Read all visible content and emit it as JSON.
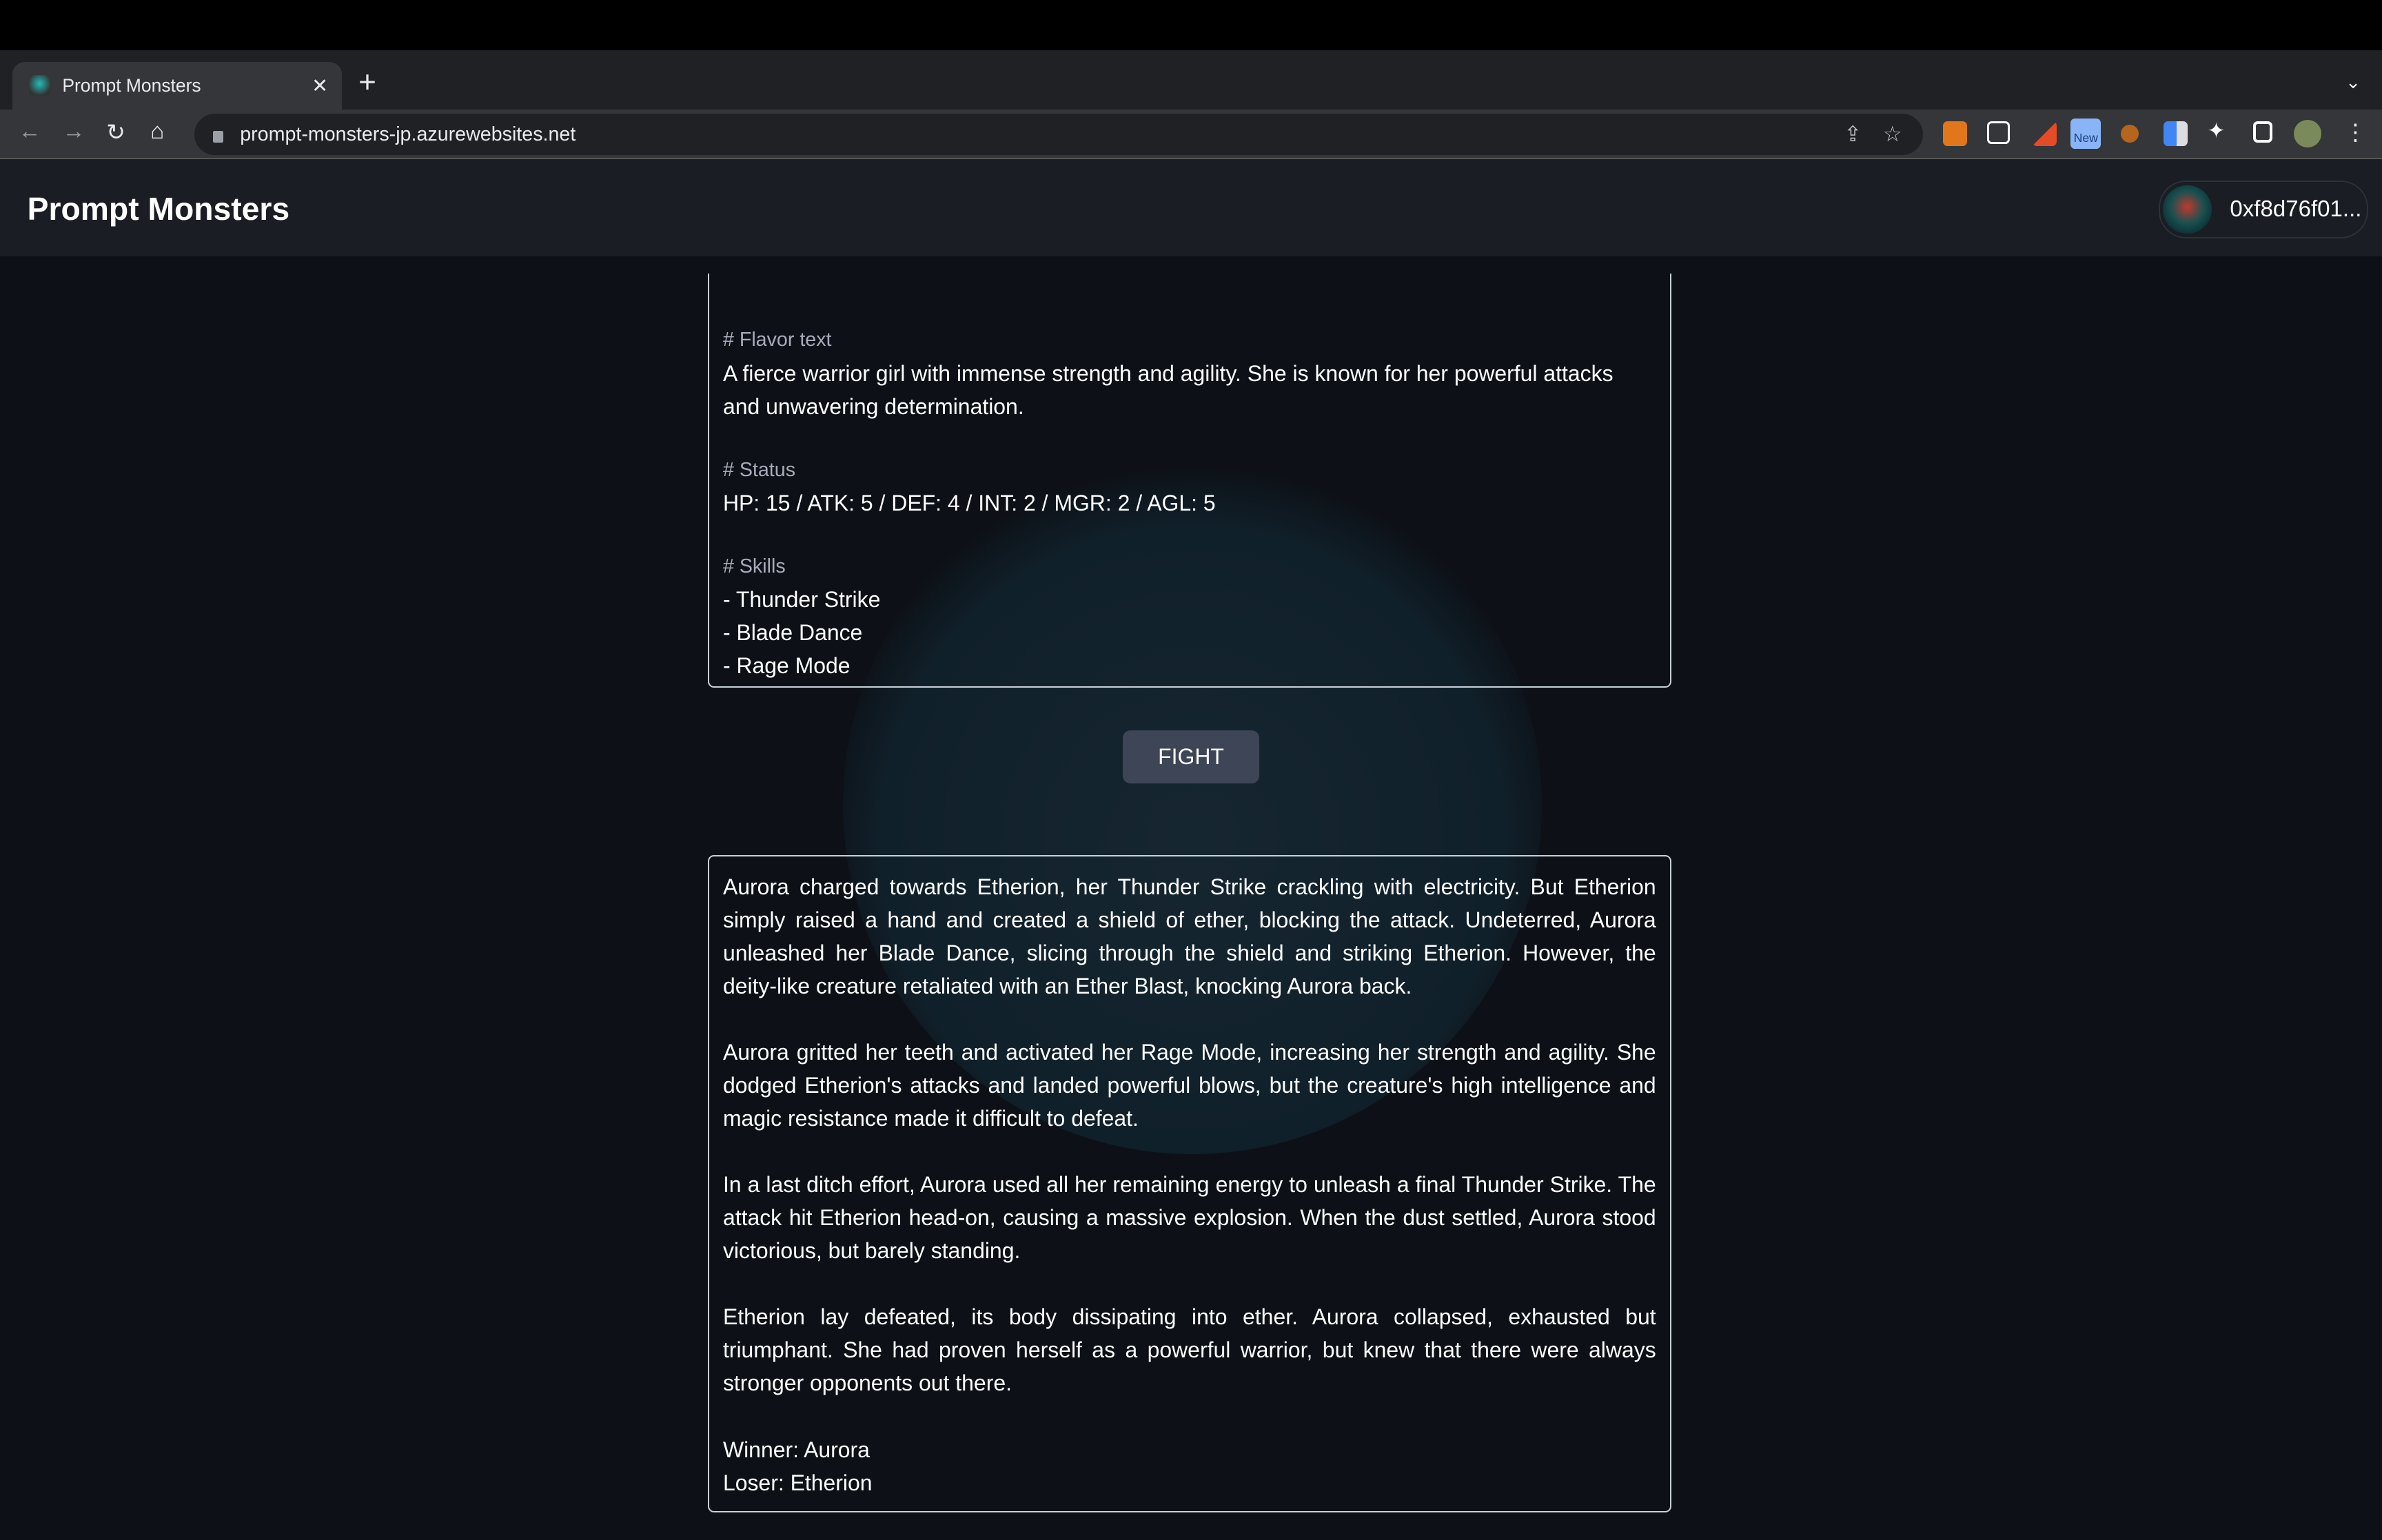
{
  "browser": {
    "tab_title": "Prompt Monsters",
    "tab_close": "✕",
    "new_tab": "+",
    "tab_menu": "⌄",
    "url": "prompt-monsters-jp.azurewebsites.net",
    "extensions": [
      "metamask-icon",
      "send-icon",
      "pen-icon",
      "new-extension-icon",
      "hedgehog-icon",
      "google-translate-icon",
      "puzzle-icon",
      "sidepanel-icon",
      "profile-avatar"
    ],
    "new_badge": "New"
  },
  "header": {
    "title": "Prompt Monsters",
    "wallet_address": "0xf8d76f01..."
  },
  "monster": {
    "flavor_label": "# Flavor text",
    "flavor_text": "A fierce warrior girl with immense strength and agility. She is known for her powerful attacks and unwavering determination.",
    "status_label": "# Status",
    "status_text": "HP: 15 / ATK: 5 / DEF: 4 / INT: 2 / MGR: 2 / AGL: 5",
    "skills_label": "# Skills",
    "skills": [
      "- Thunder Strike",
      "- Blade Dance",
      "- Rage Mode"
    ]
  },
  "fight_button": "FIGHT",
  "battle": {
    "paragraphs": [
      "Aurora charged towards Etherion, her Thunder Strike crackling with electricity. But Etherion simply raised a hand and created a shield of ether, blocking the attack. Undeterred, Aurora unleashed her Blade Dance, slicing through the shield and striking Etherion. However, the deity-like creature retaliated with an Ether Blast, knocking Aurora back.",
      "Aurora gritted her teeth and activated her Rage Mode, increasing her strength and agility. She dodged Etherion's attacks and landed powerful blows, but the creature's high intelligence and magic resistance made it difficult to defeat.",
      "In a last ditch effort, Aurora used all her remaining energy to unleash a final Thunder Strike. The attack hit Etherion head-on, causing a massive explosion. When the dust settled, Aurora stood victorious, but barely standing.",
      "Etherion lay defeated, its body dissipating into ether. Aurora collapsed, exhausted but triumphant. She had proven herself as a powerful warrior, but knew that there were always stronger opponents out there."
    ],
    "winner": "Winner: Aurora",
    "loser": "Loser: Etherion"
  }
}
